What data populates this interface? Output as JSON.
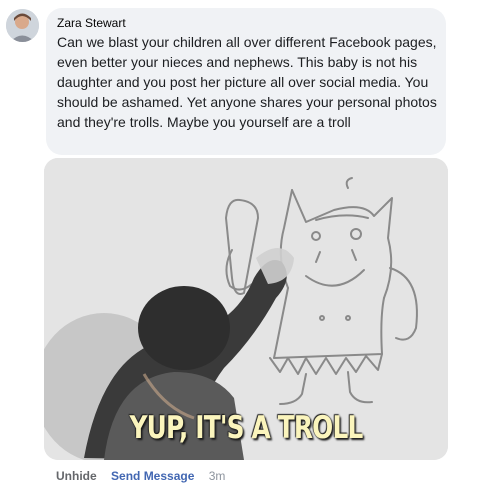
{
  "comment": {
    "author": "Zara Stewart",
    "text": "Can we blast your children all over different Facebook pages, even better your nieces and nephews. This baby is not his daughter and you post her picture all over social media. You should be ashamed. Yet anyone shares your personal photos and they're trolls. Maybe you yourself are a troll"
  },
  "gif": {
    "caption": "YUP, IT'S A TROLL"
  },
  "actions": {
    "unhide": "Unhide",
    "send_message": "Send Message",
    "timestamp": "3m"
  }
}
